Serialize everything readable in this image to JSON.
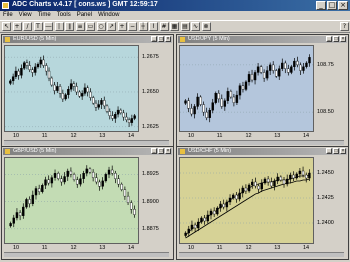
{
  "app": {
    "title": "ADC Charts v.4.17 [ cons.ws ] GMT 12:59:17"
  },
  "menu": [
    "File",
    "View",
    "Time",
    "Tools",
    "Panel",
    "Window"
  ],
  "toolbar_buttons": [
    {
      "name": "pointer-tool",
      "glyph": "↖"
    },
    {
      "name": "crosshair-tool",
      "glyph": "+"
    },
    {
      "name": "trendline-tool",
      "glyph": "/"
    },
    {
      "name": "text-tool",
      "glyph": "T"
    },
    {
      "name": "horizontal-line-tool",
      "glyph": "―"
    },
    {
      "name": "vertical-line-tool",
      "glyph": "|"
    },
    {
      "name": "channel-tool",
      "glyph": "∥"
    },
    {
      "name": "fibonacci-tool",
      "glyph": "≡"
    },
    {
      "name": "rectangle-tool",
      "glyph": "▭"
    },
    {
      "name": "ellipse-tool",
      "glyph": "○"
    },
    {
      "name": "arrow-tool",
      "glyph": "↗"
    },
    {
      "name": "zoom-in-tool",
      "glyph": "+"
    },
    {
      "name": "zoom-out-tool",
      "glyph": "−"
    },
    {
      "name": "candles-tool",
      "glyph": "┼"
    },
    {
      "name": "line-chart-tool",
      "glyph": "⌇"
    },
    {
      "name": "grid-tool",
      "glyph": "#"
    },
    {
      "name": "tile-tool",
      "glyph": "▦"
    },
    {
      "name": "cascade-tool",
      "glyph": "▤"
    },
    {
      "name": "indicator-tool",
      "glyph": "∿"
    },
    {
      "name": "close-all-tool",
      "glyph": "⊗"
    },
    {
      "name": "help-tool",
      "glyph": "?"
    }
  ],
  "panels": [
    {
      "id": "eurusd",
      "title": "EUR/USD (5 Min)",
      "bg": "#b7d7dc",
      "yticks": [
        "1.2675",
        "1.2650",
        "1.2625"
      ],
      "xticks": [
        "10",
        "11",
        "12",
        "13",
        "14"
      ]
    },
    {
      "id": "usdjpy",
      "title": "USD/JPY (5 Min)",
      "bg": "#b4c6dc",
      "yticks": [
        "108.75",
        "108.50"
      ],
      "xticks": [
        "10",
        "11",
        "12",
        "13",
        "14"
      ]
    },
    {
      "id": "gbpusd",
      "title": "GBP/USD (5 Min)",
      "bg": "#c3dcb4",
      "yticks": [
        "1.8925",
        "1.8900",
        "1.8875"
      ],
      "xticks": [
        "10",
        "11",
        "12",
        "13",
        "14"
      ]
    },
    {
      "id": "usdchf",
      "title": "USD/CHF (5 Min)",
      "bg": "#d6d296",
      "yticks": [
        "1.2450",
        "1.2425",
        "1.2400"
      ],
      "xticks": [
        "10",
        "11",
        "12",
        "13",
        "14"
      ]
    }
  ],
  "chart_data": [
    {
      "type": "candlestick",
      "title": "EUR/USD (5 Min)",
      "series": [
        {
          "name": "EUR/USD",
          "close": [
            1.2658,
            1.2661,
            1.2665,
            1.2662,
            1.2667,
            1.2671,
            1.2669,
            1.2666,
            1.2664,
            1.2668,
            1.267,
            1.2673,
            1.2669,
            1.2665,
            1.266,
            1.2655,
            1.2651,
            1.2654,
            1.2649,
            1.2645,
            1.2648,
            1.2652,
            1.2656,
            1.2654,
            1.265,
            1.2647,
            1.2649,
            1.2653,
            1.265,
            1.2646,
            1.2642,
            1.2639,
            1.2641,
            1.2644,
            1.264,
            1.2636,
            1.2633,
            1.2631,
            1.2634,
            1.2637,
            1.2635,
            1.2632,
            1.263,
            1.2628,
            1.2631,
            1.2633
          ]
        }
      ],
      "x_ticks": [
        "10",
        "11",
        "12",
        "13",
        "14"
      ],
      "y_ticks": [
        1.2675,
        1.265,
        1.2625
      ],
      "ylim": [
        1.2622,
        1.2683
      ]
    },
    {
      "type": "candlestick",
      "title": "USD/JPY (5 Min)",
      "series": [
        {
          "name": "USD/JPY",
          "close": [
            108.56,
            108.52,
            108.49,
            108.53,
            108.58,
            108.54,
            108.5,
            108.47,
            108.51,
            108.55,
            108.6,
            108.57,
            108.53,
            108.56,
            108.61,
            108.58,
            108.55,
            108.59,
            108.64,
            108.62,
            108.66,
            108.7,
            108.67,
            108.71,
            108.74,
            108.71,
            108.68,
            108.72,
            108.75,
            108.72,
            108.69,
            108.73,
            108.76,
            108.73,
            108.71,
            108.74,
            108.77,
            108.75,
            108.72,
            108.74,
            108.76,
            108.79
          ]
        }
      ],
      "x_ticks": [
        "10",
        "11",
        "12",
        "13",
        "14"
      ],
      "y_ticks": [
        108.75,
        108.5
      ],
      "ylim": [
        108.4,
        108.85
      ]
    },
    {
      "type": "candlestick",
      "title": "GBP/USD (5 Min)",
      "series": [
        {
          "name": "GBP/USD",
          "close": [
            1.888,
            1.8885,
            1.889,
            1.8887,
            1.8895,
            1.8902,
            1.8898,
            1.8906,
            1.8912,
            1.8909,
            1.8915,
            1.892,
            1.8917,
            1.8922,
            1.8926,
            1.8921,
            1.8918,
            1.8923,
            1.8928,
            1.8925,
            1.892,
            1.8916,
            1.8921,
            1.8926,
            1.893,
            1.8927,
            1.8922,
            1.8918,
            1.8914,
            1.8919,
            1.8925,
            1.8929,
            1.8926,
            1.8921,
            1.8916,
            1.8911,
            1.8905,
            1.8899,
            1.8893,
            1.8888
          ]
        }
      ],
      "x_ticks": [
        "10",
        "11",
        "12",
        "13",
        "14"
      ],
      "y_ticks": [
        1.8925,
        1.89,
        1.8875
      ],
      "ylim": [
        1.8862,
        1.894
      ]
    },
    {
      "type": "candlestick",
      "title": "USD/CHF (5 Min)",
      "series": [
        {
          "name": "USD/CHF",
          "close": [
            1.239,
            1.2394,
            1.2398,
            1.2395,
            1.2401,
            1.2405,
            1.2402,
            1.2408,
            1.2412,
            1.2409,
            1.2415,
            1.2419,
            1.2416,
            1.2421,
            1.2425,
            1.2428,
            1.2424,
            1.243,
            1.2435,
            1.2432,
            1.2438,
            1.2441,
            1.2437,
            1.2434,
            1.244,
            1.2444,
            1.2441,
            1.2437,
            1.2442,
            1.2446,
            1.2443,
            1.2439,
            1.2444,
            1.2448,
            1.2445,
            1.2449,
            1.2452,
            1.2448,
            1.2445,
            1.245
          ]
        },
        {
          "name": "MA fast",
          "values": [
            1.2388,
            1.2391,
            1.2394,
            1.2396,
            1.2399,
            1.2402,
            1.2404,
            1.2406,
            1.2409,
            1.2411,
            1.2413,
            1.2416,
            1.2418,
            1.242,
            1.2423,
            1.2425,
            1.2427,
            1.2429,
            1.2431,
            1.2433,
            1.2435,
            1.2437,
            1.2438,
            1.2439,
            1.244,
            1.2441,
            1.2441,
            1.2441,
            1.2442,
            1.2443,
            1.2443,
            1.2443,
            1.2443,
            1.2444,
            1.2445,
            1.2446,
            1.2447,
            1.2447,
            1.2447,
            1.2448
          ]
        },
        {
          "name": "MA slow",
          "values": [
            1.2385,
            1.2387,
            1.2389,
            1.2391,
            1.2393,
            1.2395,
            1.2397,
            1.2399,
            1.2401,
            1.2403,
            1.2405,
            1.2407,
            1.2409,
            1.2411,
            1.2413,
            1.2415,
            1.2417,
            1.2419,
            1.2421,
            1.2423,
            1.2425,
            1.2427,
            1.2429,
            1.243,
            1.2432,
            1.2433,
            1.2434,
            1.2435,
            1.2436,
            1.2437,
            1.2438,
            1.2439,
            1.244,
            1.244,
            1.2441,
            1.2442,
            1.2442,
            1.2443,
            1.2443,
            1.2444
          ]
        }
      ],
      "x_ticks": [
        "10",
        "11",
        "12",
        "13",
        "14"
      ],
      "y_ticks": [
        1.245,
        1.2425,
        1.24
      ],
      "ylim": [
        1.238,
        1.2465
      ]
    }
  ]
}
